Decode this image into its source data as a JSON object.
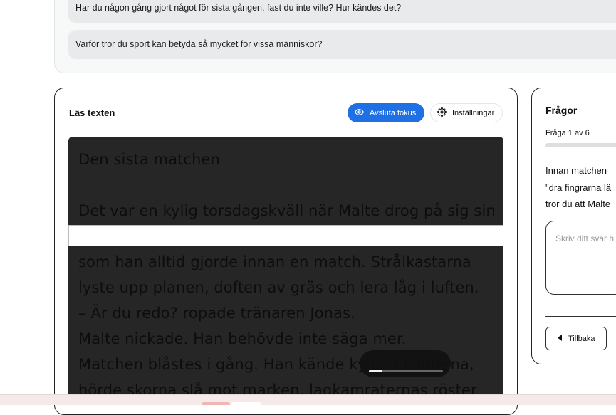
{
  "discussion": {
    "questions": [
      "Har du någon gång gjort något för sista gången, fast du inte ville? Hur kändes det?",
      "Varför tror du sport kan betyda så mycket för vissa människor?"
    ]
  },
  "reader": {
    "title": "Läs texten",
    "focus_button_label": "Avsluta fokus",
    "settings_button_label": "Inställningar",
    "lines": [
      "Den sista matchen",
      "Det var en kylig torsdagskväll när Malte drog på sig sin",
      "som han alltid gjorde innan en match. Strålkastarna",
      "lyste upp planen, doften av gräs och lera låg i luften.",
      "– Är du redo? ropade tränaren Jonas.",
      "Malte nickade. Han behövde inte säga mer.",
      "Matchen blåstes i gång. Han kände kylan i kinderna,",
      "hörde skorna slå mot marken, lagkamraternas röster"
    ],
    "player_progress": 0.18
  },
  "questions_panel": {
    "title": "Frågor",
    "counter": "Fråga 1 av 6",
    "question_lines": [
      "Innan matchen",
      "\"dra fingrarna lä",
      "tror du att Malte"
    ],
    "answer_placeholder": "Skriv ditt svar h",
    "back_label": "Tillbaka"
  },
  "colors": {
    "accent": "#1f6fe5",
    "reader_bg": "#262626"
  }
}
